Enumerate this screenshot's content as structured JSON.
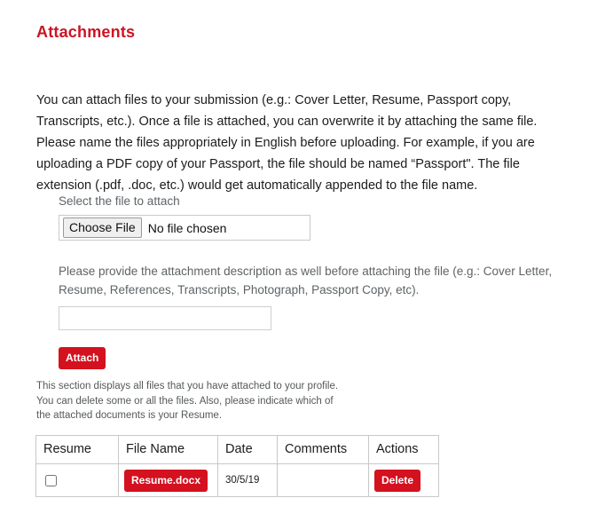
{
  "page": {
    "title": "Attachments",
    "title_color": "#cc1425",
    "accent_color": "#d4111f",
    "intro_paragraph": "You can attach files to your submission (e.g.: Cover Letter, Resume, Passport copy, Transcripts, etc.).  Once a file is attached, you can overwrite it by attaching the same file. Please name the files appropriately in English before uploading. For example, if you are uploading a PDF copy of your Passport, the file should be named “Passport\". The file extension (.pdf, .doc, etc.) would get automatically appended to the file name."
  },
  "form": {
    "file_label": "Select the file to attach",
    "choose_file_button": "Choose File",
    "file_status": "No file chosen",
    "description_help": "Please provide the attachment description as well before attaching the file (e.g.: Cover Letter, Resume, References, Transcripts, Photograph, Passport Copy, etc).",
    "description_value": "",
    "description_placeholder": "",
    "attach_button": "Attach"
  },
  "attachments_section": {
    "note": "This section displays all files that you have attached to your profile. You can delete some or all the files. Also, please indicate which of the attached documents is your Resume.",
    "columns": [
      "Resume",
      "File Name",
      "Date",
      "Comments",
      "Actions"
    ],
    "rows": [
      {
        "resume_checked": false,
        "file_name": "Resume.docx",
        "date": "30/5/19",
        "comments": "",
        "action_label": "Delete"
      }
    ]
  }
}
